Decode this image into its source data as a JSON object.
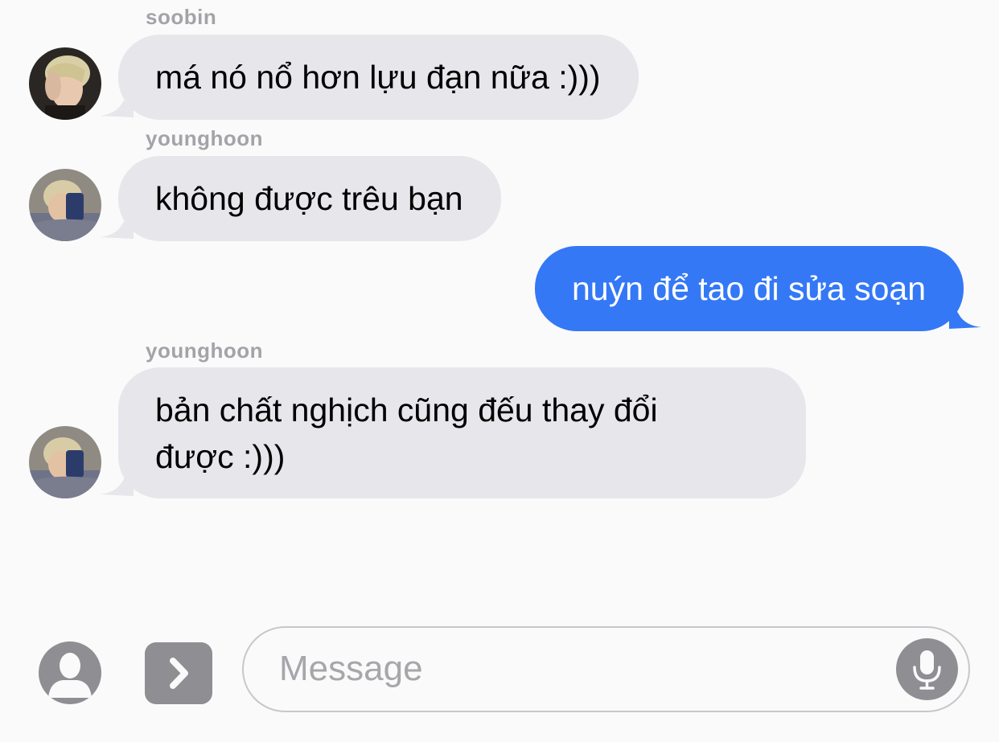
{
  "conversation": {
    "messages": [
      {
        "sender": "soobin",
        "direction": "incoming",
        "text": "má nó nổ hơn lựu đạn nữa :)))"
      },
      {
        "sender": "younghoon",
        "direction": "incoming",
        "text": "không được trêu bạn"
      },
      {
        "sender": "",
        "direction": "outgoing",
        "text": "nuýn để tao đi sửa soạn"
      },
      {
        "sender": "younghoon",
        "direction": "incoming",
        "text": "bản chất nghịch cũng đếu thay đổi\nđược :)))"
      }
    ]
  },
  "input_bar": {
    "placeholder": "Message",
    "contact_icon": "person-silhouette-icon",
    "apps_icon": "chevron-right-icon",
    "mic_icon": "microphone-icon"
  },
  "colors": {
    "incoming_bubble": "#e6e6eb",
    "outgoing_bubble": "#3478f6",
    "sender_name": "#a3a3a8",
    "background": "#fafafa",
    "icon_gray": "#8e8e93"
  }
}
